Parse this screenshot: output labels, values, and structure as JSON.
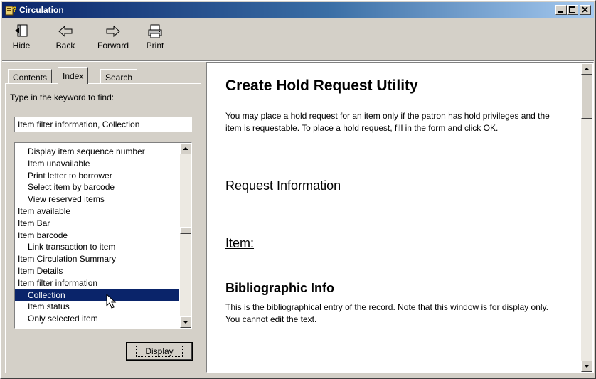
{
  "window": {
    "title": "Circulation"
  },
  "toolbar": {
    "buttons": [
      {
        "label": "Hide",
        "icon": "hide-pane-icon"
      },
      {
        "label": "Back",
        "icon": "back-arrow-icon"
      },
      {
        "label": "Forward",
        "icon": "forward-arrow-icon"
      },
      {
        "label": "Print",
        "icon": "printer-icon"
      }
    ]
  },
  "tabs": [
    {
      "label": "Contents",
      "active": false
    },
    {
      "label": "Index",
      "active": true
    },
    {
      "label": "Search",
      "active": false
    }
  ],
  "index": {
    "prompt": "Type in the keyword to find:",
    "keyword_value": "Item filter information, Collection",
    "items": [
      {
        "label": "Display item sequence number",
        "sub": true
      },
      {
        "label": "Item unavailable",
        "sub": true
      },
      {
        "label": "Print letter to borrower",
        "sub": true
      },
      {
        "label": "Select item by barcode",
        "sub": true
      },
      {
        "label": "View reserved items",
        "sub": true
      },
      {
        "label": "Item available",
        "sub": false
      },
      {
        "label": "Item Bar",
        "sub": false
      },
      {
        "label": "Item barcode",
        "sub": false
      },
      {
        "label": "Link transaction to item",
        "sub": true
      },
      {
        "label": "Item Circulation Summary",
        "sub": false
      },
      {
        "label": "Item Details",
        "sub": false
      },
      {
        "label": "Item filter information",
        "sub": false
      },
      {
        "label": "Collection",
        "sub": true,
        "selected": true
      },
      {
        "label": "Item status",
        "sub": true
      },
      {
        "label": "Only selected item",
        "sub": true
      }
    ],
    "display_button": "Display"
  },
  "content": {
    "title": "Create Hold Request Utility",
    "intro": "You may place a hold request for an item only if the patron has hold privileges and the item is requestable. To place a hold request, fill in the form and click OK.",
    "section_request": "Request Information",
    "section_item": "Item:",
    "section_biblio": "Bibliographic Info",
    "biblio_text": "This is the bibliographical entry of the record. Note that this window is for display only. You cannot edit the text."
  },
  "colors": {
    "titlebar_start": "#0a246a",
    "titlebar_end": "#a6caf0",
    "selection": "#0a246a",
    "face": "#d4d0c8"
  }
}
